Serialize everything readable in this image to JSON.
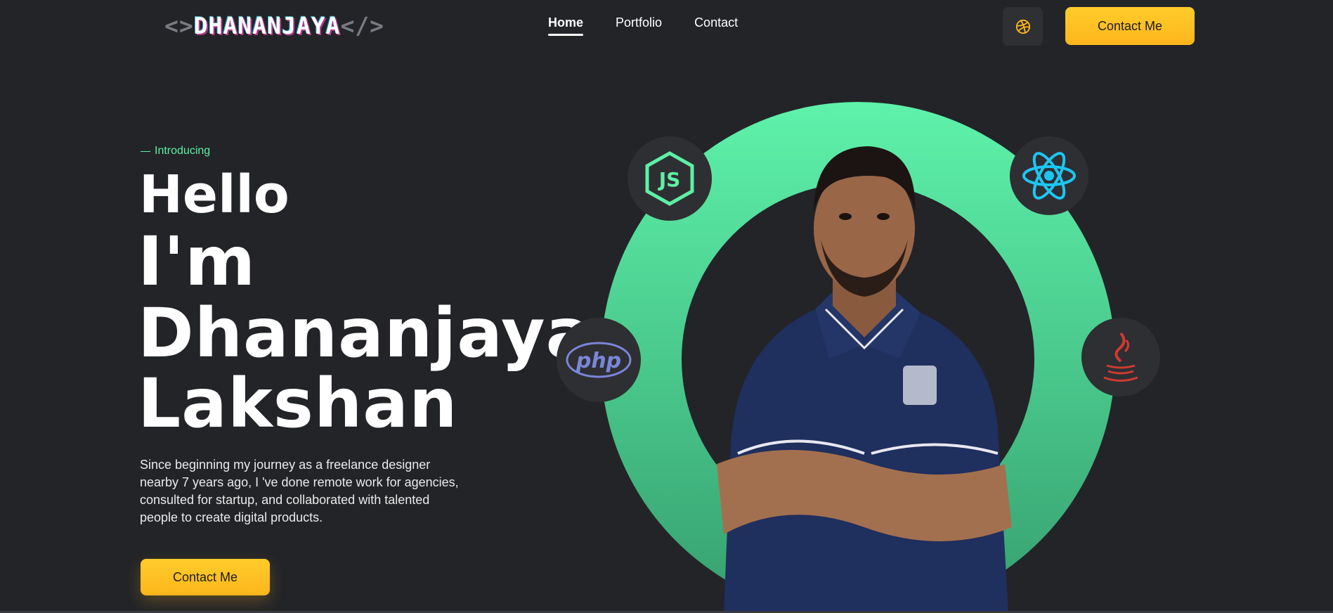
{
  "header": {
    "logo": {
      "open": "<>",
      "name": "DHANANJAYA",
      "close": "</>"
    },
    "nav": [
      {
        "label": "Home",
        "active": true
      },
      {
        "label": "Portfolio",
        "active": false
      },
      {
        "label": "Contact",
        "active": false
      }
    ],
    "dribbble_icon": "dribbble-icon",
    "cta_label": "Contact Me"
  },
  "hero": {
    "intro": "Introducing",
    "hello": "Hello",
    "line1": "I'm",
    "line2": "Dhananjaya",
    "line3": "Lakshan",
    "description": "Since beginning my journey as a freelance designer nearby 7 years ago, I 've done remote work for agencies, consulted for startup, and collaborated with talented people to create digital products.",
    "cta_label": "Contact Me"
  },
  "tech_badges": [
    {
      "icon": "nodejs-icon",
      "label": "JS"
    },
    {
      "icon": "react-icon"
    },
    {
      "icon": "php-icon",
      "label": "php"
    },
    {
      "icon": "java-icon"
    }
  ],
  "colors": {
    "background": "#232428",
    "accent_green": "#5ef0a5",
    "button_yellow": "#fdb61c",
    "badge_bg": "#2e2f33"
  }
}
